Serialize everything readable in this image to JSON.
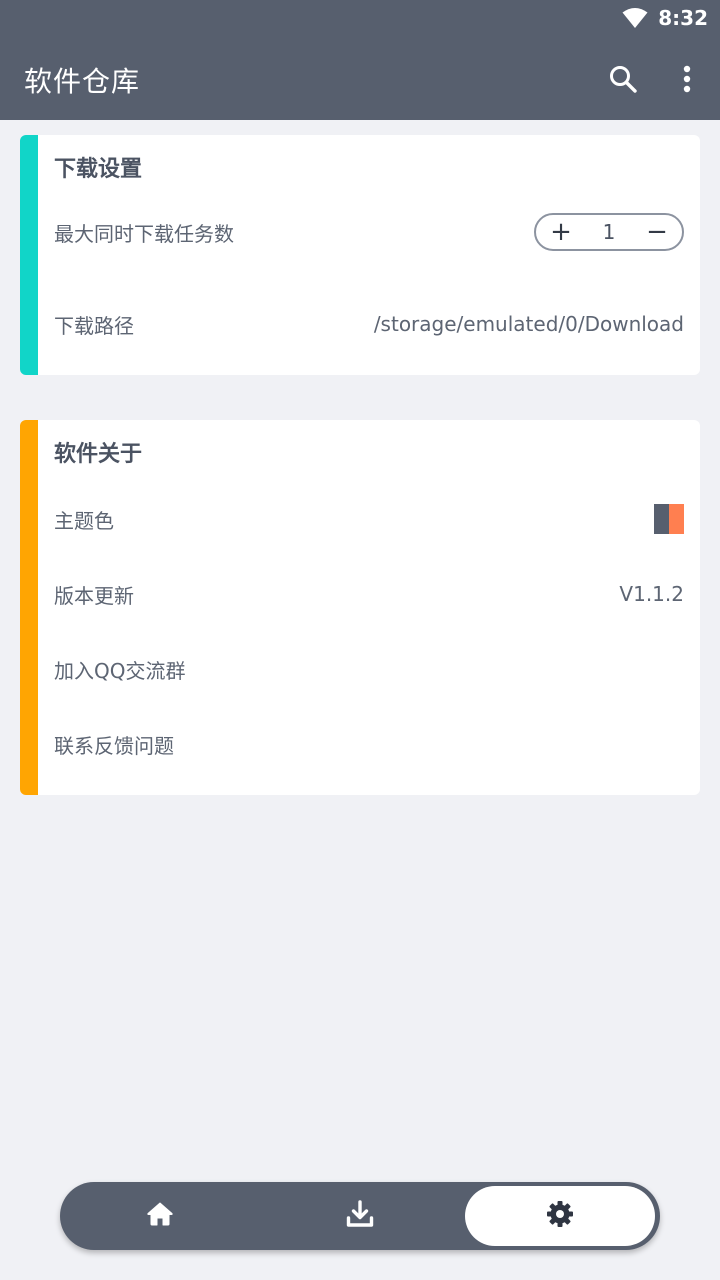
{
  "status_bar": {
    "time": "8:32"
  },
  "app_bar": {
    "title": "软件仓库"
  },
  "download_settings": {
    "title": "下载设置",
    "max_tasks_label": "最大同时下载任务数",
    "max_tasks_value": "1",
    "plus_label": "+",
    "minus_label": "−",
    "path_label": "下载路径",
    "path_value": "/storage/emulated/0/Download"
  },
  "about": {
    "title": "软件关于",
    "theme_label": "主题色",
    "theme_colors": [
      "#575f6e",
      "#ff7f50"
    ],
    "update_label": "版本更新",
    "update_value": "V1.1.2",
    "qq_label": "加入QQ交流群",
    "feedback_label": "联系反馈问题"
  },
  "colors": {
    "primary": "#575f6e",
    "accent_download": "#11d5c8",
    "accent_about": "#ffa502",
    "background": "#f0f1f5"
  },
  "bottom_nav": {
    "items": [
      {
        "icon": "home-icon",
        "active": false
      },
      {
        "icon": "download-icon",
        "active": false
      },
      {
        "icon": "settings-icon",
        "active": true
      }
    ]
  }
}
